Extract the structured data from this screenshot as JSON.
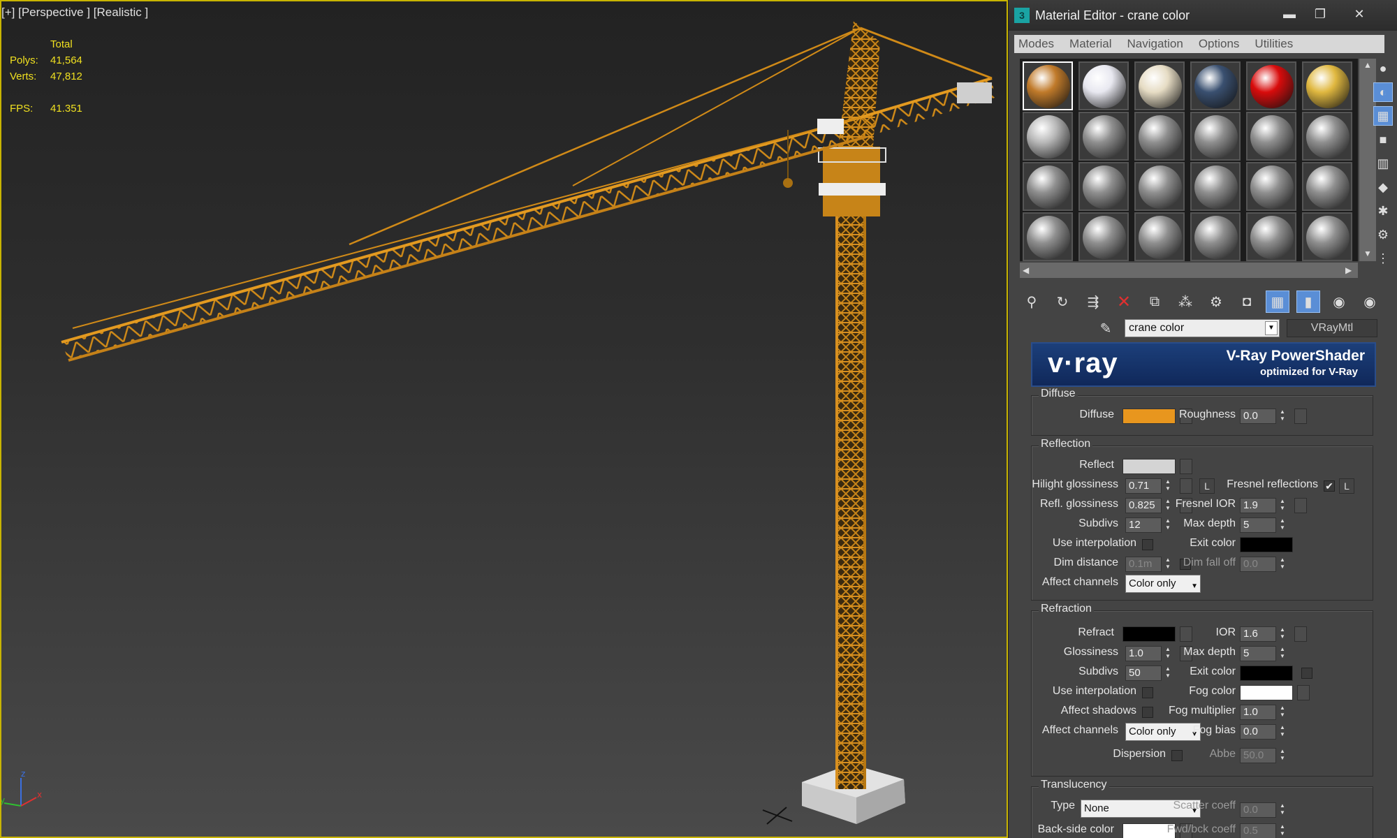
{
  "viewport": {
    "label": "[+] [Perspective ] [Realistic ]",
    "stats": {
      "header": "Total",
      "polys_label": "Polys:",
      "polys": "41,564",
      "verts_label": "Verts:",
      "verts": "47,812",
      "fps_label": "FPS:",
      "fps": "41.351"
    },
    "axis": {
      "x": "x",
      "y": "y",
      "z": "z"
    }
  },
  "material_editor": {
    "title": "Material Editor - crane color",
    "menu": [
      "Modes",
      "Material",
      "Navigation",
      "Options",
      "Utilities"
    ],
    "window_buttons": {
      "minimize": "▬",
      "maximize": "❐",
      "close": "✕"
    },
    "material_name": "crane color",
    "material_type": "VRayMtl",
    "banner": {
      "logo": "v·ray",
      "title": "V-Ray PowerShader",
      "subtitle": "optimized for V-Ray"
    },
    "slot_colors": [
      "#c07a2a",
      "#e8e8f0",
      "#e6dcc4",
      "#3a5070",
      "#d80c0c",
      "#e0b840",
      "#b8b8b8",
      "#8f8f8f"
    ],
    "diffuse": {
      "group": "Diffuse",
      "diffuse_label": "Diffuse",
      "diffuse_color": "#e8961e",
      "roughness_label": "Roughness",
      "roughness": "0.0"
    },
    "reflection": {
      "group": "Reflection",
      "reflect_label": "Reflect",
      "reflect_color": "#d4d4d4",
      "hilight_label": "Hilight glossiness",
      "hilight": "0.71",
      "l_label": "L",
      "fresnel_label": "Fresnel reflections",
      "fresnel_checked": "✔",
      "refl_gloss_label": "Refl. glossiness",
      "refl_gloss": "0.825",
      "fresnel_ior_label": "Fresnel IOR",
      "fresnel_ior": "1.9",
      "subdivs_label": "Subdivs",
      "subdivs": "12",
      "max_depth_label": "Max depth",
      "max_depth": "5",
      "use_interp_label": "Use interpolation",
      "exit_color_label": "Exit color",
      "exit_color": "#000000",
      "dim_distance_label": "Dim distance",
      "dim_distance": "0.1m",
      "dim_falloff_label": "Dim fall off",
      "dim_falloff": "0.0",
      "affect_channels_label": "Affect channels",
      "affect_channels": "Color only"
    },
    "refraction": {
      "group": "Refraction",
      "refract_label": "Refract",
      "refract_color": "#000000",
      "ior_label": "IOR",
      "ior": "1.6",
      "glossiness_label": "Glossiness",
      "glossiness": "1.0",
      "max_depth_label": "Max depth",
      "max_depth": "5",
      "subdivs_label": "Subdivs",
      "subdivs": "50",
      "exit_color_label": "Exit color",
      "exit_color": "#000000",
      "use_interp_label": "Use interpolation",
      "fog_color_label": "Fog color",
      "fog_color": "#ffffff",
      "affect_shadows_label": "Affect shadows",
      "fog_mult_label": "Fog multiplier",
      "fog_mult": "1.0",
      "affect_channels_label": "Affect channels",
      "affect_channels": "Color only",
      "fog_bias_label": "Fog bias",
      "fog_bias": "0.0",
      "dispersion_label": "Dispersion",
      "abbe_label": "Abbe",
      "abbe": "50.0"
    },
    "translucency": {
      "group": "Translucency",
      "type_label": "Type",
      "type": "None",
      "scatter_label": "Scatter coeff",
      "scatter": "0.0",
      "backside_label": "Back-side color",
      "backside_color": "#ffffff",
      "fwdbck_label": "Fwd/bck coeff",
      "fwdbck": "0.5"
    }
  }
}
